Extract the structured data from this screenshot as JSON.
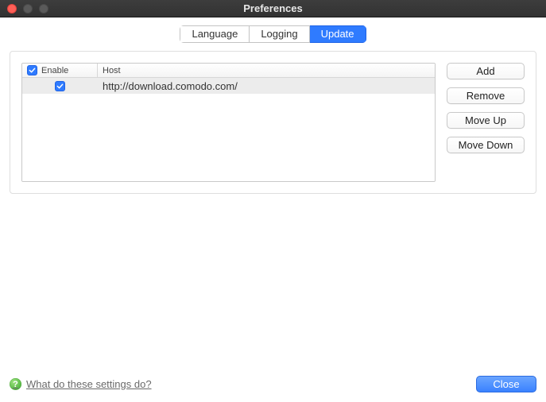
{
  "window": {
    "title": "Preferences"
  },
  "tabs": [
    {
      "label": "Language",
      "active": false
    },
    {
      "label": "Logging",
      "active": false
    },
    {
      "label": "Update",
      "active": true
    }
  ],
  "table": {
    "header_enable": "Enable",
    "header_host": "Host",
    "header_checked": true,
    "rows": [
      {
        "enabled": true,
        "host": "http://download.comodo.com/",
        "selected": true
      }
    ]
  },
  "buttons": {
    "add": "Add",
    "remove": "Remove",
    "move_up": "Move Up",
    "move_down": "Move Down"
  },
  "footer": {
    "help_text": "What do these settings do?",
    "close": "Close"
  }
}
